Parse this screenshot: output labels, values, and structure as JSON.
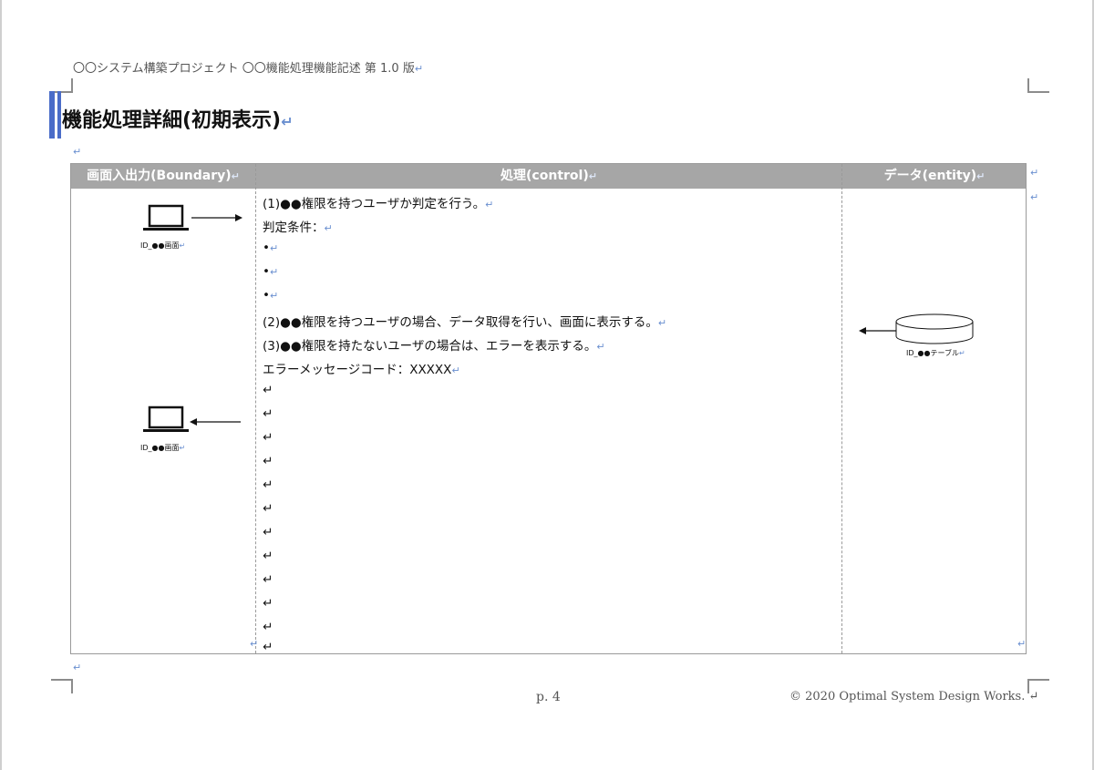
{
  "header": {
    "text": "〇〇システム構築プロジェクト 〇〇機能処理機能記述 第 1.0 版"
  },
  "title": {
    "text": "機能処理詳細(初期表示)"
  },
  "table": {
    "columns": [
      "画面入出力(Boundary)",
      "処理(control)",
      "データ(entity)"
    ],
    "control_lines": [
      "(1)●●権限を持つユーザか判定を行う。",
      "判定条件：",
      "•",
      "•",
      "•",
      "(2)●●権限を持つユーザの場合、データ取得を行い、画面に表示する。",
      "(3)●●権限を持たないユーザの場合は、エラーを表示する。",
      "エラーメッセージコード：XXXXX"
    ],
    "screen_label_1": "ID_●●画面",
    "screen_label_2": "ID_●●画面",
    "table_label": "ID_●●テーブル"
  },
  "footer": {
    "page": "p. 4",
    "copyright": "© 2020 Optimal System Design Works."
  },
  "icons": [
    "laptop-icon",
    "database-icon",
    "arrow-icon",
    "return-mark-icon"
  ]
}
